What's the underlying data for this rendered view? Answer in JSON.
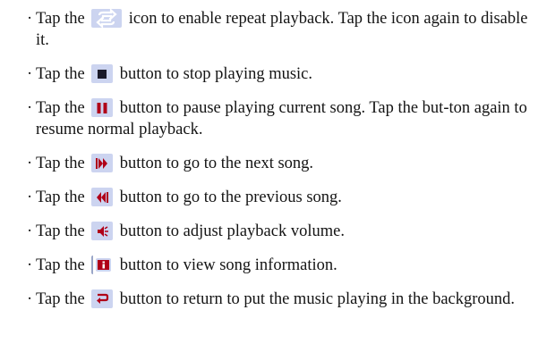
{
  "items": [
    {
      "icon": "repeat-icon",
      "before": "Tap the",
      "after": "icon to enable repeat playback. Tap the icon again to disable it."
    },
    {
      "icon": "stop-icon",
      "before": "Tap the",
      "after": "button to stop playing music."
    },
    {
      "icon": "pause-icon",
      "before": "Tap the",
      "after": "button to pause playing current song. Tap the but-ton again to resume normal playback."
    },
    {
      "icon": "next-song-icon",
      "before": "Tap the",
      "after": "button to go to the next song."
    },
    {
      "icon": "previous-song-icon",
      "before": "Tap the",
      "after": "button to go to the previous song."
    },
    {
      "icon": "volume-icon",
      "before": "Tap the",
      "after": "button to adjust playback volume."
    },
    {
      "icon": "info-icon",
      "before": "Tap the",
      "after": "button to view song information."
    },
    {
      "icon": "background-return-icon",
      "before": "Tap the",
      "after": "button to return to put the music playing in the background."
    }
  ],
  "colors": {
    "icon_background": "#ccd4f0",
    "icon_glyph": "#b00018",
    "text": "#141414"
  }
}
